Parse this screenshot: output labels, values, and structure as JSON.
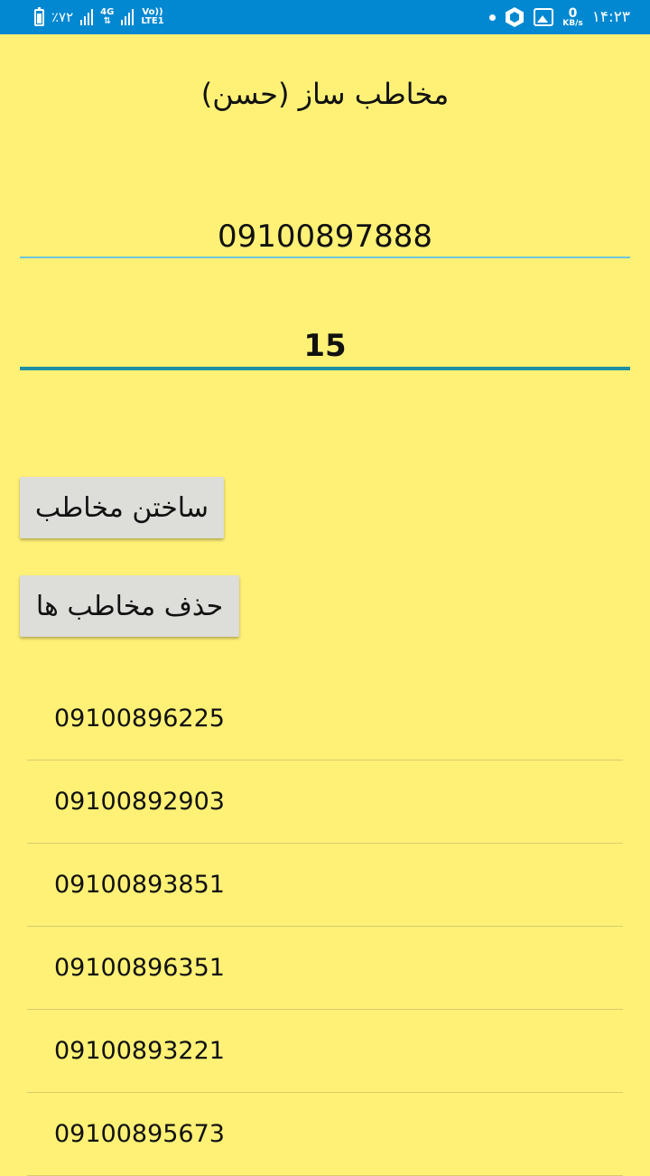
{
  "status_bar": {
    "battery": "٪۷۲",
    "network_type": "4G",
    "volte_line1": "Vo))",
    "volte_line2": "LTE1",
    "speed_value": "0",
    "speed_unit": "KB/s",
    "time": "۱۴:۲۳"
  },
  "app": {
    "title": "مخاطب ساز (حسن)",
    "phone_value": "09100897888",
    "count_value": "15",
    "create_button": "ساختن مخاطب",
    "delete_button": "حذف مخاطب ها"
  },
  "contacts": [
    "09100896225",
    "09100892903",
    "09100893851",
    "09100896351",
    "09100893221",
    "09100895673"
  ]
}
